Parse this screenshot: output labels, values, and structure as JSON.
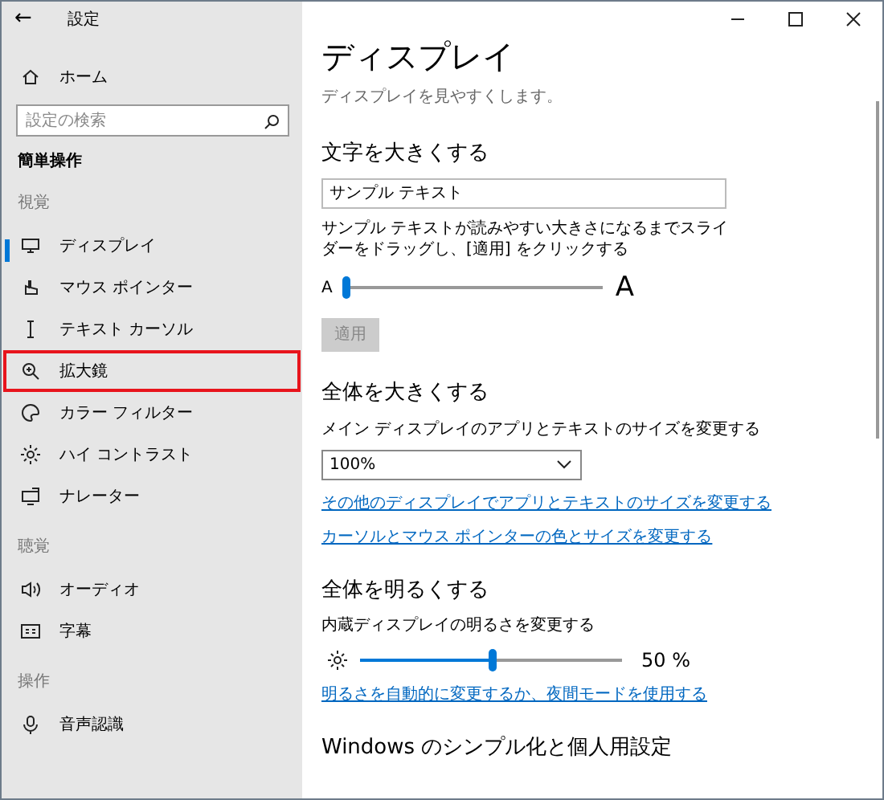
{
  "window": {
    "title": "設定",
    "back": "←"
  },
  "sidebar": {
    "home": "ホーム",
    "search": {
      "placeholder": "設定の検索"
    },
    "category": "簡単操作",
    "groups": [
      {
        "heading": "視覚",
        "items": [
          {
            "label": "ディスプレイ",
            "selected": true,
            "highlighted": false
          },
          {
            "label": "マウス ポインター",
            "selected": false,
            "highlighted": false
          },
          {
            "label": "テキスト カーソル",
            "selected": false,
            "highlighted": false
          },
          {
            "label": "拡大鏡",
            "selected": false,
            "highlighted": true
          },
          {
            "label": "カラー フィルター",
            "selected": false,
            "highlighted": false
          },
          {
            "label": "ハイ コントラスト",
            "selected": false,
            "highlighted": false
          },
          {
            "label": "ナレーター",
            "selected": false,
            "highlighted": false
          }
        ]
      },
      {
        "heading": "聴覚",
        "items": [
          {
            "label": "オーディオ",
            "selected": false,
            "highlighted": false
          },
          {
            "label": "字幕",
            "selected": false,
            "highlighted": false
          }
        ]
      },
      {
        "heading": "操作",
        "items": [
          {
            "label": "音声認識",
            "selected": false,
            "highlighted": false
          }
        ]
      }
    ]
  },
  "page": {
    "title": "ディスプレイ",
    "subtitle": "ディスプレイを見やすくします。",
    "sections": [
      {
        "kind": "textsize",
        "heading": "文字を大きくする",
        "sample": "サンプル テキスト",
        "description": "サンプル テキストが読みやすい大きさになるまでスライダーをドラッグし、[適用] をクリックする",
        "small_label": "A",
        "large_label": "A",
        "level": 0.0,
        "button": {
          "label": "適用",
          "disabled": true
        }
      },
      {
        "kind": "scale",
        "heading": "全体を大きくする",
        "label": "メイン ディスプレイのアプリとテキストのサイズを変更する",
        "value": "100%",
        "links": [
          "その他のディスプレイでアプリとテキストのサイズを変更する",
          "カーソルとマウス ポインターの色とサイズを変更する"
        ]
      },
      {
        "kind": "brightness",
        "heading": "全体を明るくする",
        "label": "内蔵ディスプレイの明るさを変更する",
        "level": 0.5,
        "reading": "50 %",
        "links": [
          "明るさを自動的に変更するか、夜間モードを使用する"
        ]
      },
      {
        "kind": "heading",
        "heading": "Windows のシンプル化と個人用設定"
      }
    ]
  }
}
